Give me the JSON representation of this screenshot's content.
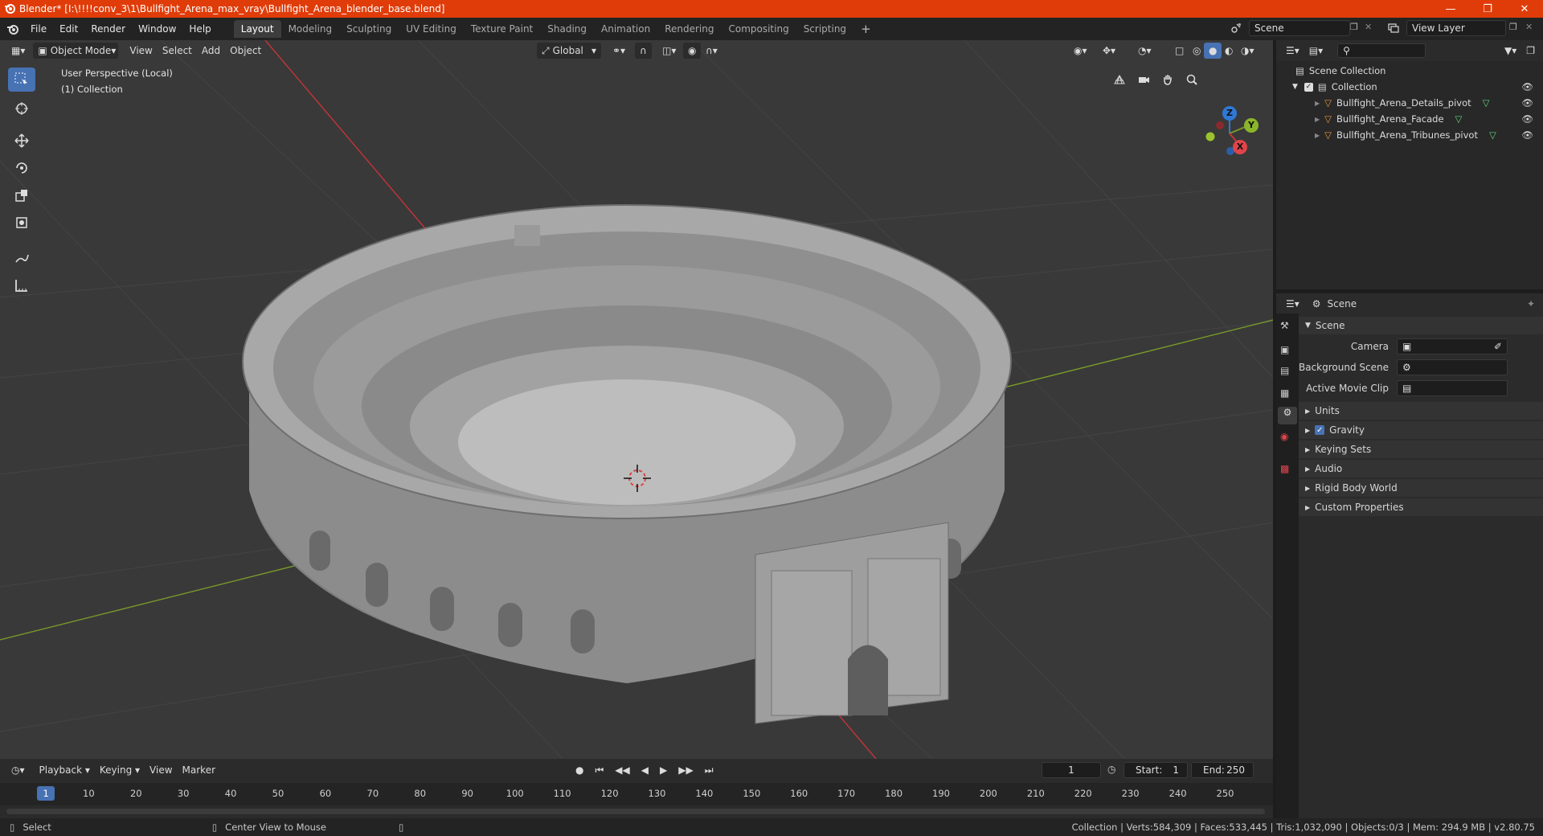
{
  "title_bar": {
    "title": "Blender* [I:\\!!!!conv_3\\1\\Bullfight_Arena_max_vray\\Bullfight_Arena_blender_base.blend]"
  },
  "menus": [
    "File",
    "Edit",
    "Render",
    "Window",
    "Help"
  ],
  "workspaces": [
    "Layout",
    "Modeling",
    "Sculpting",
    "UV Editing",
    "Texture Paint",
    "Shading",
    "Animation",
    "Rendering",
    "Compositing",
    "Scripting"
  ],
  "active_workspace": "Layout",
  "scene_field": "Scene",
  "view_layer_field": "View Layer",
  "viewport": {
    "mode": "Object Mode",
    "menus": [
      "View",
      "Select",
      "Add",
      "Object"
    ],
    "transform_orientation": "Global",
    "overlay_line1": "User Perspective (Local)",
    "overlay_line2": "(1) Collection",
    "gizmo": {
      "z": "Z",
      "y": "Y",
      "x": "X"
    }
  },
  "outliner": {
    "root": "Scene Collection",
    "collection": "Collection",
    "objects": [
      "Bullfight_Arena_Details_pivot",
      "Bullfight_Arena_Facade",
      "Bullfight_Arena_Tribunes_pivot"
    ]
  },
  "properties": {
    "header": "Scene",
    "panel": "Scene",
    "fields": [
      {
        "label": "Camera",
        "value": ""
      },
      {
        "label": "Background Scene",
        "value": ""
      },
      {
        "label": "Active Movie Clip",
        "value": ""
      }
    ],
    "sections": [
      "Units",
      "Gravity",
      "Keying Sets",
      "Audio",
      "Rigid Body World",
      "Custom Properties"
    ],
    "gravity_checked": true
  },
  "timeline": {
    "menus": [
      "Playback",
      "Keying",
      "View",
      "Marker"
    ],
    "current_frame": "1",
    "start_label": "Start:",
    "start": "1",
    "end_label": "End:",
    "end": "250",
    "ticks": [
      "1",
      "10",
      "20",
      "30",
      "40",
      "50",
      "60",
      "70",
      "80",
      "90",
      "100",
      "110",
      "120",
      "130",
      "140",
      "150",
      "160",
      "170",
      "180",
      "190",
      "200",
      "210",
      "220",
      "230",
      "240",
      "250"
    ]
  },
  "status_bar": {
    "left": "Select",
    "middle": "Center View to Mouse",
    "right": "Collection | Verts:584,309 | Faces:533,445 | Tris:1,032,090 | Objects:0/3 | Mem: 294.9 MB | v2.80.75"
  },
  "colors": {
    "title_bar": "#e03c09",
    "accent": "#4772b3",
    "axis_x": "#c4343a",
    "axis_y": "#7a9a2a",
    "axis_z": "#2f79d6",
    "mesh": "#9a9a9a"
  }
}
